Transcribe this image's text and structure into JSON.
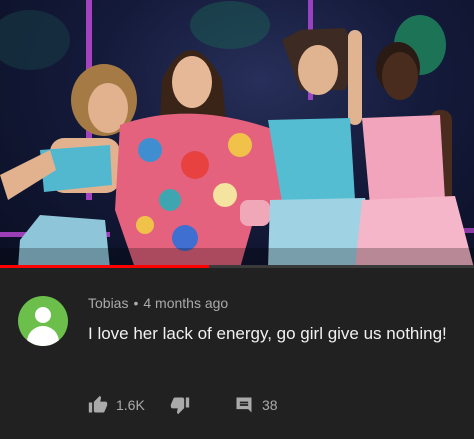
{
  "video": {
    "progress_fraction": 0.44
  },
  "comment": {
    "author": "Tobias",
    "separator": "•",
    "timestamp": "4 months ago",
    "text": "I love her lack of energy, go girl give us nothing!",
    "like_count": "1.6K",
    "reply_count": "38",
    "avatar_color": "#6bbf4a",
    "icons": {
      "like": "thumbs-up-icon",
      "dislike": "thumbs-down-icon",
      "reply": "comment-icon"
    }
  }
}
